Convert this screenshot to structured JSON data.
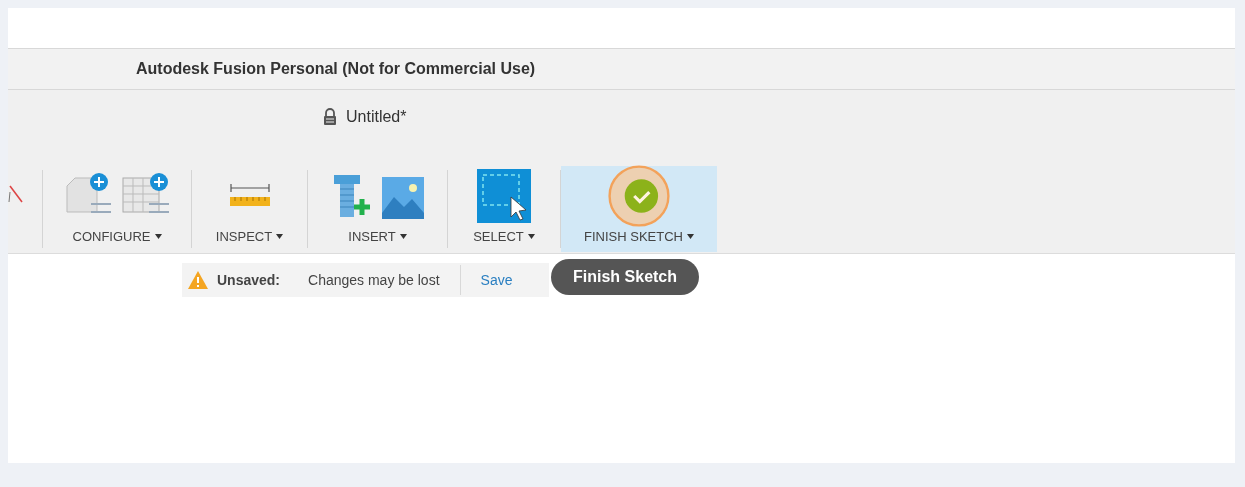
{
  "window": {
    "title": "Autodesk Fusion Personal (Not for Commercial Use)"
  },
  "document": {
    "title": "Untitled*",
    "locked": true
  },
  "toolbar": {
    "groups": [
      {
        "label": "CONFIGURE",
        "highlighted": false
      },
      {
        "label": "INSPECT",
        "highlighted": false
      },
      {
        "label": "INSERT",
        "highlighted": false
      },
      {
        "label": "SELECT",
        "highlighted": false
      },
      {
        "label": "FINISH SKETCH",
        "highlighted": true
      }
    ]
  },
  "notice": {
    "status": "Unsaved:",
    "message": "Changes may be lost",
    "action": "Save"
  },
  "tooltip": {
    "text": "Finish Sketch"
  }
}
